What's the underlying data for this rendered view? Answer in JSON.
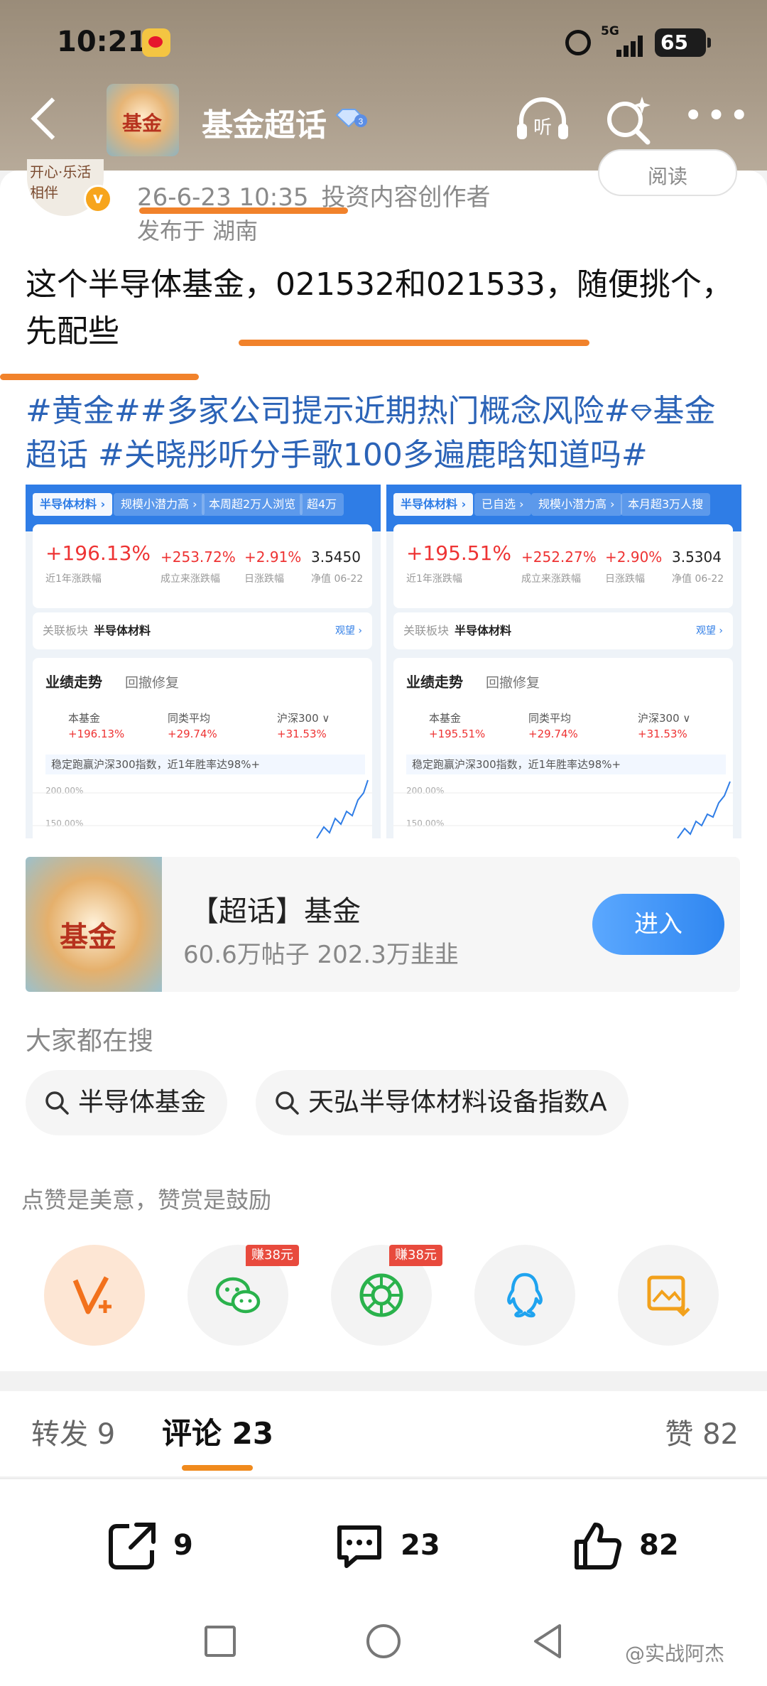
{
  "status_bar": {
    "time": "10:21",
    "network": "5G",
    "battery": "65"
  },
  "header": {
    "title": "基金超话",
    "avatar_text": "基金"
  },
  "post": {
    "author_avatar_text": "开心·乐活相伴",
    "verified_mark": "v",
    "read_label": "阅读",
    "datetime": "26-6-23 10:35",
    "author_tag": "投资内容创作者",
    "location": "发布于 湖南",
    "text": "这个半导体基金，021532和021533，随便挑个，先配些",
    "tags_line1_a": "#黄金##多家公司提示近期热门概念风险#",
    "tags_line1_b": "基金",
    "tags_line2": "超话 #关晓彤听分手歌100多遍鹿晗知道吗#"
  },
  "screenshots": [
    {
      "tabs": [
        "半导体材料 ›",
        "规模小潜力高 ›",
        "本周超2万人浏览",
        "超4万"
      ],
      "return_1y": "+196.13%",
      "return_1y_label": "近1年涨跌幅",
      "since_inception": "+253.72%",
      "since_inception_label": "成立来涨跌幅",
      "daily": "+2.91%",
      "daily_label": "日涨跌幅",
      "nav": "3.5450",
      "nav_label": "净值 06-22",
      "sector_label": "关联板块",
      "sector_name": "半导体材料",
      "sector_link": "观望 ›",
      "perf_title": "业绩走势",
      "perf_tab2": "回撤修复",
      "legend": [
        "本基金",
        "同类平均",
        "沪深300 ∨"
      ],
      "legend_values": [
        "+196.13%",
        "+29.74%",
        "+31.53%"
      ],
      "note": "稳定跑赢沪深300指数，近1年胜率达98%+",
      "y_labels": [
        "200.00%",
        "150.00%"
      ]
    },
    {
      "tabs": [
        "半导体材料 ›",
        "已自选 ›",
        "规模小潜力高 ›",
        "本月超3万人搜"
      ],
      "return_1y": "+195.51%",
      "return_1y_label": "近1年涨跌幅",
      "since_inception": "+252.27%",
      "since_inception_label": "成立来涨跌幅",
      "daily": "+2.90%",
      "daily_label": "日涨跌幅",
      "nav": "3.5304",
      "nav_label": "净值 06-22",
      "sector_label": "关联板块",
      "sector_name": "半导体材料",
      "sector_link": "观望 ›",
      "perf_title": "业绩走势",
      "perf_tab2": "回撤修复",
      "legend": [
        "本基金",
        "同类平均",
        "沪深300 ∨"
      ],
      "legend_values": [
        "+195.51%",
        "+29.74%",
        "+31.53%"
      ],
      "note": "稳定跑赢沪深300指数，近1年胜率达98%+",
      "y_labels": [
        "200.00%",
        "150.00%"
      ]
    }
  ],
  "topic_card": {
    "thumb_text": "基金",
    "name": "【超话】基金",
    "stats": "60.6万帖子 202.3万韭韭",
    "join": "进入"
  },
  "search": {
    "heading": "大家都在搜",
    "chips": [
      "半导体基金",
      "天弘半导体材料设备指数A"
    ]
  },
  "share": {
    "tip": "点赞是美意，赞赏是鼓励",
    "reward_wechat": "赚38元",
    "reward_moments": "赚38元"
  },
  "tabs": {
    "forward": "转发 9",
    "comments": "评论 23",
    "likes": "赞 82"
  },
  "actions": {
    "forward_count": "9",
    "comment_count": "23",
    "like_count": "82"
  },
  "watermark": "@实战阿杰",
  "colors": {
    "accent_orange": "#f1822b",
    "link_blue": "#2b63b7",
    "weibo_orange": "#f08a1d"
  }
}
